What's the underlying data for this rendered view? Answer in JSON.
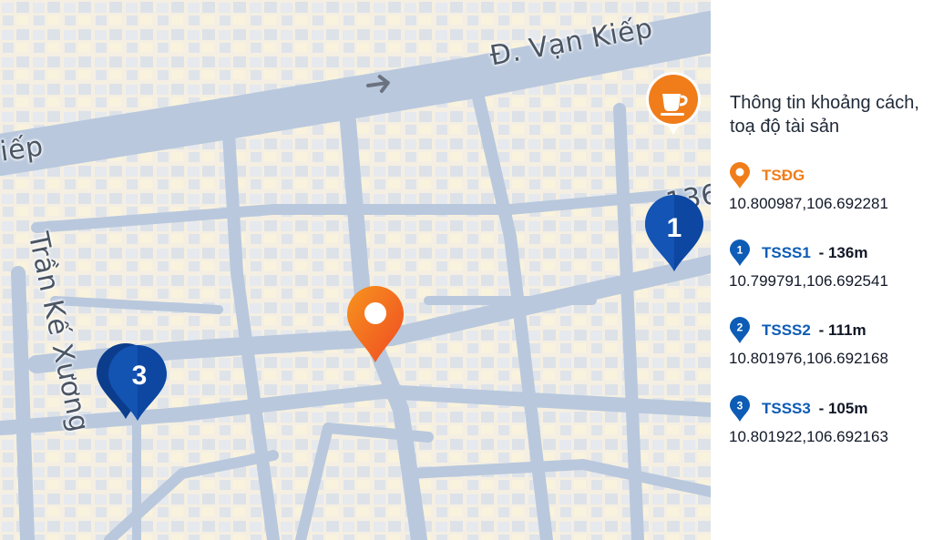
{
  "map": {
    "streets": [
      {
        "id": "van-kiep-main",
        "label": "Đ. Vạn Kiếp"
      },
      {
        "id": "van-kiep-left",
        "label": "iếp"
      },
      {
        "id": "tran-ke-xuong",
        "label": "Trần Kế Xương"
      },
      {
        "id": "partial-number",
        "label": "136"
      }
    ],
    "direction_arrow": "right-arrow-icon",
    "poi": {
      "icon": "coffee-cup-icon",
      "color": "#f07d1a"
    },
    "subject_pin": {
      "label": "TSĐG",
      "color": "#f26522"
    },
    "comparable_pins": [
      {
        "number": "1",
        "color": "#0d47a1"
      },
      {
        "number": "3",
        "color": "#0d47a1"
      }
    ]
  },
  "panel": {
    "title": "Thông tin khoảng cách, toạ độ tài sản",
    "entries": [
      {
        "name": "TSĐG",
        "distance": "",
        "coords": "10.800987,106.692281",
        "icon": "orange-location-pin-icon",
        "name_color": "#f07d1a"
      },
      {
        "name": "TSSS1",
        "distance": " - 136m",
        "coords": "10.799791,106.692541",
        "icon": "blue-pin-1-icon",
        "badge": "1",
        "name_color": "#0d5cb6"
      },
      {
        "name": "TSSS2",
        "distance": " - 111m",
        "coords": "10.801976,106.692168",
        "icon": "blue-pin-2-icon",
        "badge": "2",
        "name_color": "#0d5cb6"
      },
      {
        "name": "TSSS3",
        "distance": " - 105m",
        "coords": "10.801922,106.692163",
        "icon": "blue-pin-3-icon",
        "badge": "3",
        "name_color": "#0d5cb6"
      }
    ]
  }
}
